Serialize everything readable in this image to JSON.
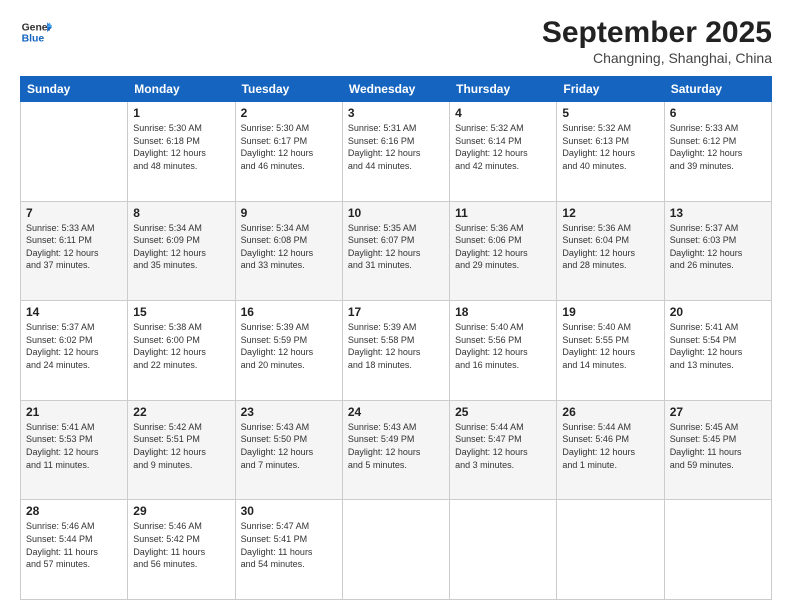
{
  "header": {
    "logo_line1": "General",
    "logo_line2": "Blue",
    "month_year": "September 2025",
    "location": "Changning, Shanghai, China"
  },
  "weekdays": [
    "Sunday",
    "Monday",
    "Tuesday",
    "Wednesday",
    "Thursday",
    "Friday",
    "Saturday"
  ],
  "weeks": [
    [
      {
        "day": "",
        "info": ""
      },
      {
        "day": "1",
        "info": "Sunrise: 5:30 AM\nSunset: 6:18 PM\nDaylight: 12 hours\nand 48 minutes."
      },
      {
        "day": "2",
        "info": "Sunrise: 5:30 AM\nSunset: 6:17 PM\nDaylight: 12 hours\nand 46 minutes."
      },
      {
        "day": "3",
        "info": "Sunrise: 5:31 AM\nSunset: 6:16 PM\nDaylight: 12 hours\nand 44 minutes."
      },
      {
        "day": "4",
        "info": "Sunrise: 5:32 AM\nSunset: 6:14 PM\nDaylight: 12 hours\nand 42 minutes."
      },
      {
        "day": "5",
        "info": "Sunrise: 5:32 AM\nSunset: 6:13 PM\nDaylight: 12 hours\nand 40 minutes."
      },
      {
        "day": "6",
        "info": "Sunrise: 5:33 AM\nSunset: 6:12 PM\nDaylight: 12 hours\nand 39 minutes."
      }
    ],
    [
      {
        "day": "7",
        "info": "Sunrise: 5:33 AM\nSunset: 6:11 PM\nDaylight: 12 hours\nand 37 minutes."
      },
      {
        "day": "8",
        "info": "Sunrise: 5:34 AM\nSunset: 6:09 PM\nDaylight: 12 hours\nand 35 minutes."
      },
      {
        "day": "9",
        "info": "Sunrise: 5:34 AM\nSunset: 6:08 PM\nDaylight: 12 hours\nand 33 minutes."
      },
      {
        "day": "10",
        "info": "Sunrise: 5:35 AM\nSunset: 6:07 PM\nDaylight: 12 hours\nand 31 minutes."
      },
      {
        "day": "11",
        "info": "Sunrise: 5:36 AM\nSunset: 6:06 PM\nDaylight: 12 hours\nand 29 minutes."
      },
      {
        "day": "12",
        "info": "Sunrise: 5:36 AM\nSunset: 6:04 PM\nDaylight: 12 hours\nand 28 minutes."
      },
      {
        "day": "13",
        "info": "Sunrise: 5:37 AM\nSunset: 6:03 PM\nDaylight: 12 hours\nand 26 minutes."
      }
    ],
    [
      {
        "day": "14",
        "info": "Sunrise: 5:37 AM\nSunset: 6:02 PM\nDaylight: 12 hours\nand 24 minutes."
      },
      {
        "day": "15",
        "info": "Sunrise: 5:38 AM\nSunset: 6:00 PM\nDaylight: 12 hours\nand 22 minutes."
      },
      {
        "day": "16",
        "info": "Sunrise: 5:39 AM\nSunset: 5:59 PM\nDaylight: 12 hours\nand 20 minutes."
      },
      {
        "day": "17",
        "info": "Sunrise: 5:39 AM\nSunset: 5:58 PM\nDaylight: 12 hours\nand 18 minutes."
      },
      {
        "day": "18",
        "info": "Sunrise: 5:40 AM\nSunset: 5:56 PM\nDaylight: 12 hours\nand 16 minutes."
      },
      {
        "day": "19",
        "info": "Sunrise: 5:40 AM\nSunset: 5:55 PM\nDaylight: 12 hours\nand 14 minutes."
      },
      {
        "day": "20",
        "info": "Sunrise: 5:41 AM\nSunset: 5:54 PM\nDaylight: 12 hours\nand 13 minutes."
      }
    ],
    [
      {
        "day": "21",
        "info": "Sunrise: 5:41 AM\nSunset: 5:53 PM\nDaylight: 12 hours\nand 11 minutes."
      },
      {
        "day": "22",
        "info": "Sunrise: 5:42 AM\nSunset: 5:51 PM\nDaylight: 12 hours\nand 9 minutes."
      },
      {
        "day": "23",
        "info": "Sunrise: 5:43 AM\nSunset: 5:50 PM\nDaylight: 12 hours\nand 7 minutes."
      },
      {
        "day": "24",
        "info": "Sunrise: 5:43 AM\nSunset: 5:49 PM\nDaylight: 12 hours\nand 5 minutes."
      },
      {
        "day": "25",
        "info": "Sunrise: 5:44 AM\nSunset: 5:47 PM\nDaylight: 12 hours\nand 3 minutes."
      },
      {
        "day": "26",
        "info": "Sunrise: 5:44 AM\nSunset: 5:46 PM\nDaylight: 12 hours\nand 1 minute."
      },
      {
        "day": "27",
        "info": "Sunrise: 5:45 AM\nSunset: 5:45 PM\nDaylight: 11 hours\nand 59 minutes."
      }
    ],
    [
      {
        "day": "28",
        "info": "Sunrise: 5:46 AM\nSunset: 5:44 PM\nDaylight: 11 hours\nand 57 minutes."
      },
      {
        "day": "29",
        "info": "Sunrise: 5:46 AM\nSunset: 5:42 PM\nDaylight: 11 hours\nand 56 minutes."
      },
      {
        "day": "30",
        "info": "Sunrise: 5:47 AM\nSunset: 5:41 PM\nDaylight: 11 hours\nand 54 minutes."
      },
      {
        "day": "",
        "info": ""
      },
      {
        "day": "",
        "info": ""
      },
      {
        "day": "",
        "info": ""
      },
      {
        "day": "",
        "info": ""
      }
    ]
  ]
}
